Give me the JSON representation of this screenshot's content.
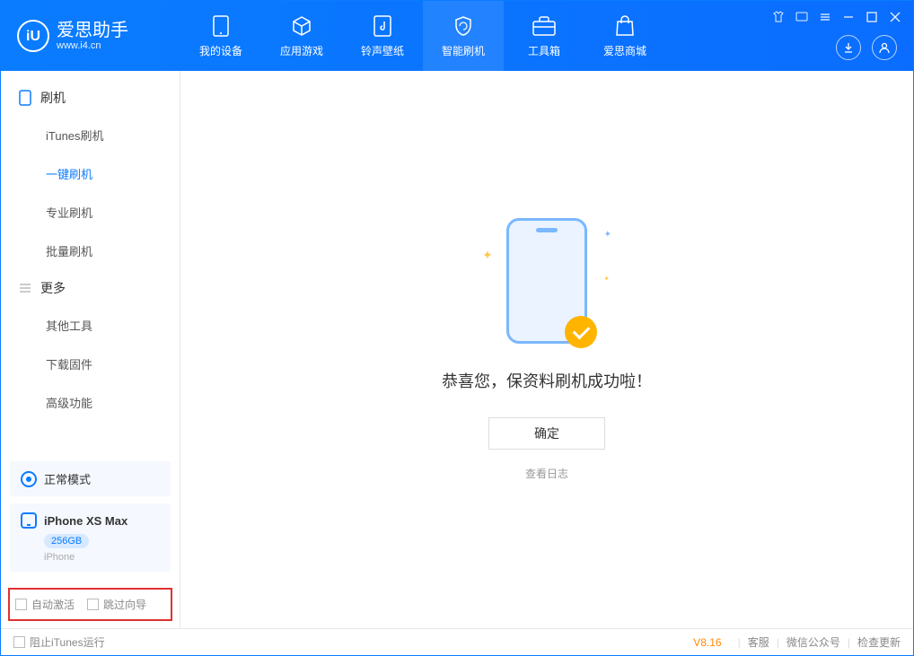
{
  "app": {
    "title": "爱思助手",
    "subtitle": "www.i4.cn"
  },
  "nav": {
    "items": [
      {
        "label": "我的设备"
      },
      {
        "label": "应用游戏"
      },
      {
        "label": "铃声壁纸"
      },
      {
        "label": "智能刷机"
      },
      {
        "label": "工具箱"
      },
      {
        "label": "爱思商城"
      }
    ]
  },
  "sidebar": {
    "section1_title": "刷机",
    "section1_items": [
      "iTunes刷机",
      "一键刷机",
      "专业刷机",
      "批量刷机"
    ],
    "section2_title": "更多",
    "section2_items": [
      "其他工具",
      "下载固件",
      "高级功能"
    ],
    "status_label": "正常模式",
    "device_name": "iPhone XS Max",
    "device_storage": "256GB",
    "device_type": "iPhone",
    "checkbox1": "自动激活",
    "checkbox2": "跳过向导"
  },
  "main": {
    "success_message": "恭喜您，保资料刷机成功啦！",
    "confirm_button": "确定",
    "log_link": "查看日志"
  },
  "footer": {
    "block_itunes": "阻止iTunes运行",
    "version": "V8.16",
    "link1": "客服",
    "link2": "微信公众号",
    "link3": "检查更新"
  }
}
